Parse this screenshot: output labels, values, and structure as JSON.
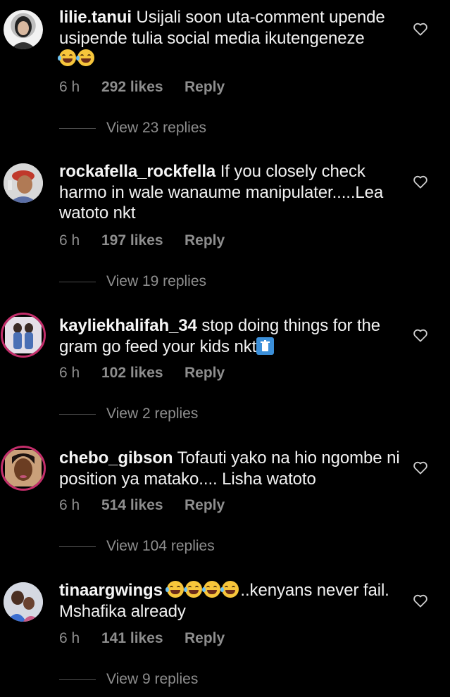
{
  "comments": [
    {
      "username": "lilie.tanui",
      "text": "Usijali soon uta-comment upende usipende tulia social media ikutengeneze",
      "emoji_count": 2,
      "time": "6 h",
      "likes": "292 likes",
      "reply": "Reply",
      "view_replies": "View 23 replies"
    },
    {
      "username": "rockafella_rockfella",
      "text": "If you closely check harmo in wale wanaume manipulater.....Lea watoto nkt",
      "time": "6 h",
      "likes": "197 likes",
      "reply": "Reply",
      "view_replies": "View 19 replies"
    },
    {
      "username": "kayliekhalifah_34",
      "text": "stop doing things for the gram go feed your kids nkt",
      "time": "6 h",
      "likes": "102 likes",
      "reply": "Reply",
      "view_replies": "View 2 replies"
    },
    {
      "username": "chebo_gibson",
      "text": "Tofauti yako na hio ngombe ni position ya matako.... Lisha watoto",
      "time": "6 h",
      "likes": "514 likes",
      "reply": "Reply",
      "view_replies": "View 104 replies"
    },
    {
      "username": "tinaargwings",
      "text": "..kenyans never fail. Mshafika already",
      "emoji_count": 4,
      "time": "6 h",
      "likes": "141 likes",
      "reply": "Reply",
      "view_replies": "View 9 replies"
    }
  ],
  "icons": {
    "like": "heart-outline-icon",
    "emoji": "laughing-tears-emoji",
    "trash": "wastebasket-emoji"
  },
  "colors": {
    "background": "#000000",
    "text": "#f2f2f2",
    "muted": "#8e8e8e",
    "story_ring": "#c42e6b"
  }
}
